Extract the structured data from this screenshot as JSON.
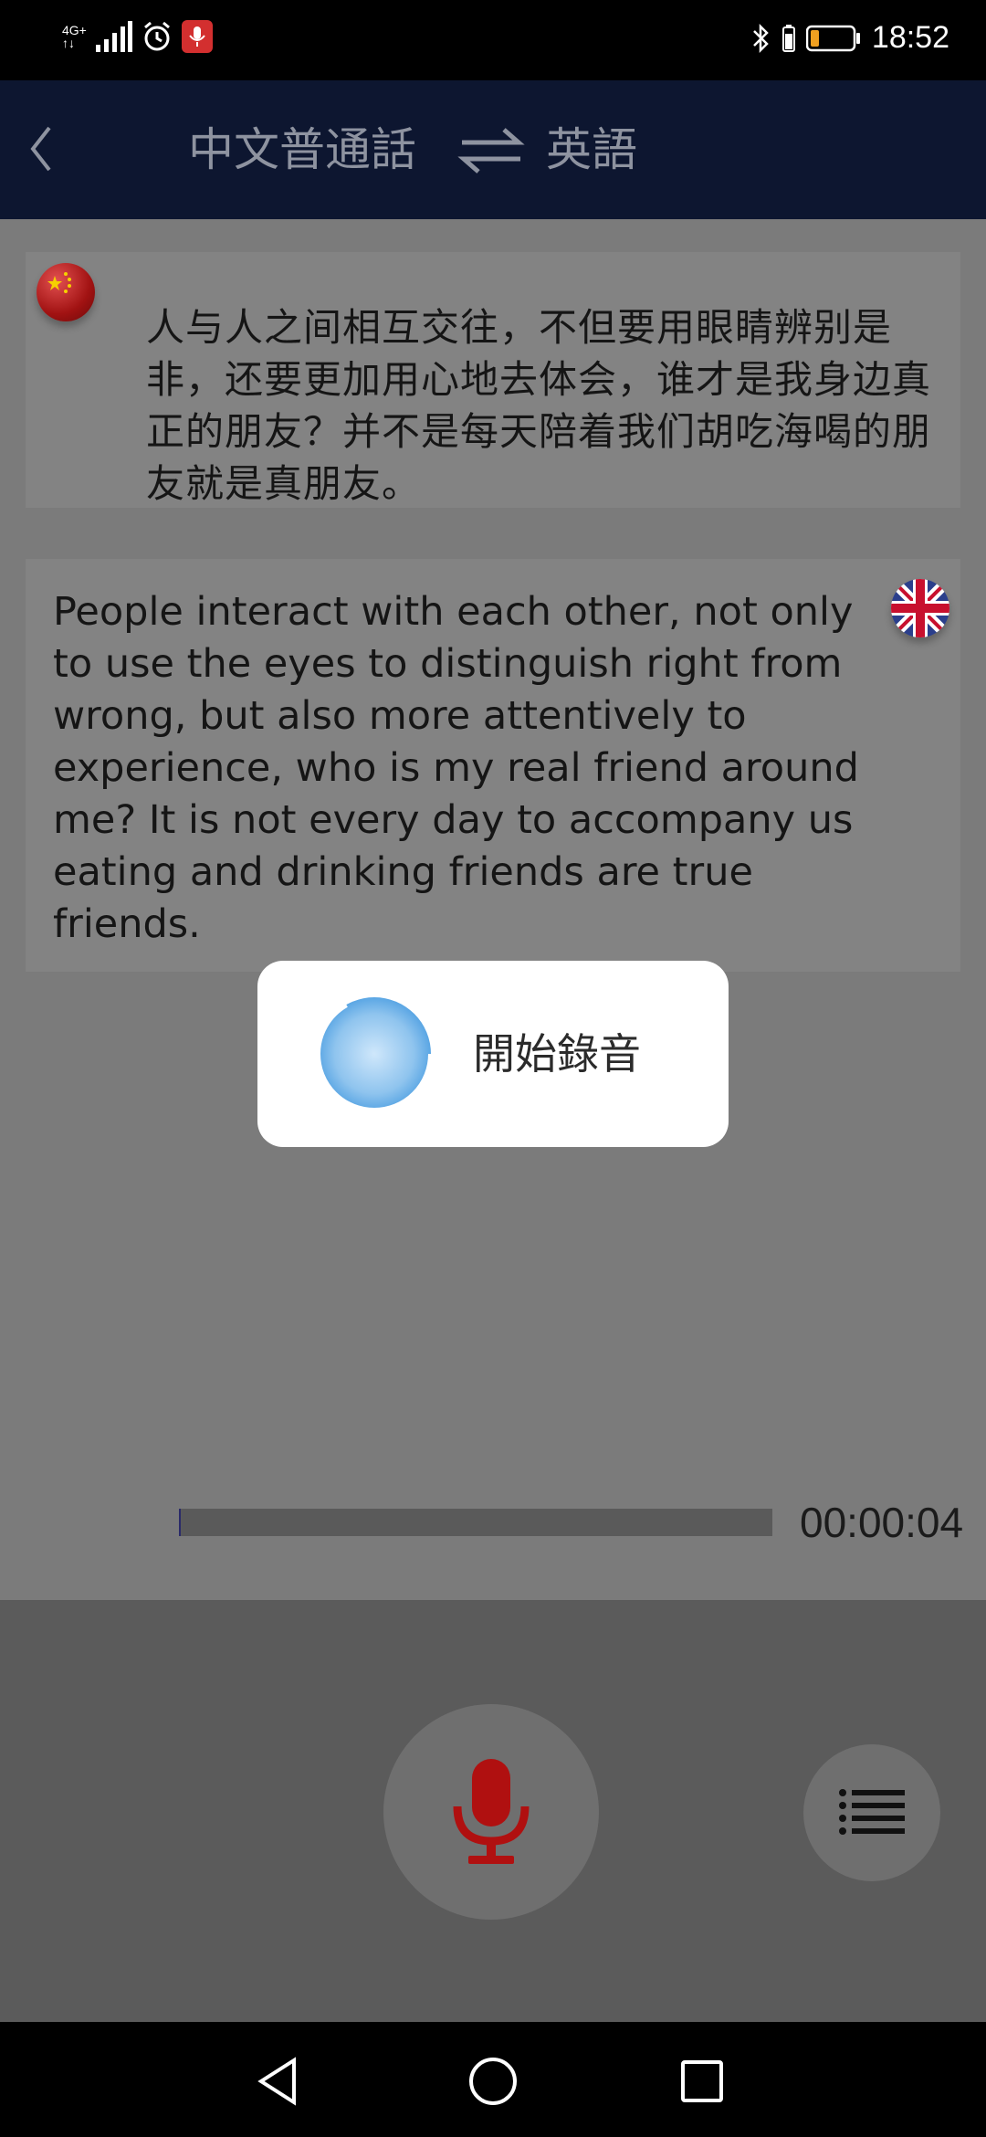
{
  "status_bar": {
    "network_top": "4G+",
    "network_bottom": "↑↓",
    "time": "18:52"
  },
  "header": {
    "source_language": "中文普通話",
    "target_language": "英語"
  },
  "source_card": {
    "text": "人与人之间相互交往，不但要用眼睛辨别是非，还要更加用心地去体会，谁才是我身边真正的朋友？并不是每天陪着我们胡吃海喝的朋友就是真朋友。"
  },
  "translation_card": {
    "text": "People interact with each other, not only to use the eyes to distinguish right from wrong, but also more attentively to experience, who is my real friend around me? It is not every day to accompany us eating and drinking friends are true friends."
  },
  "recording": {
    "timer": "00:00:04",
    "progress": 0.003,
    "dialog_label": "開始錄音"
  },
  "colors": {
    "header_bg": "#0d1630",
    "mic_red": "#b01010",
    "recording_badge": "#d32f2f",
    "battery_orange": "#f0a020"
  },
  "icons": {
    "back": "chevron-left-icon",
    "swap": "swap-arrows-icon",
    "mic": "microphone-icon",
    "menu": "list-menu-icon",
    "source_flag": "china-flag-icon",
    "target_flag": "uk-flag-icon"
  }
}
